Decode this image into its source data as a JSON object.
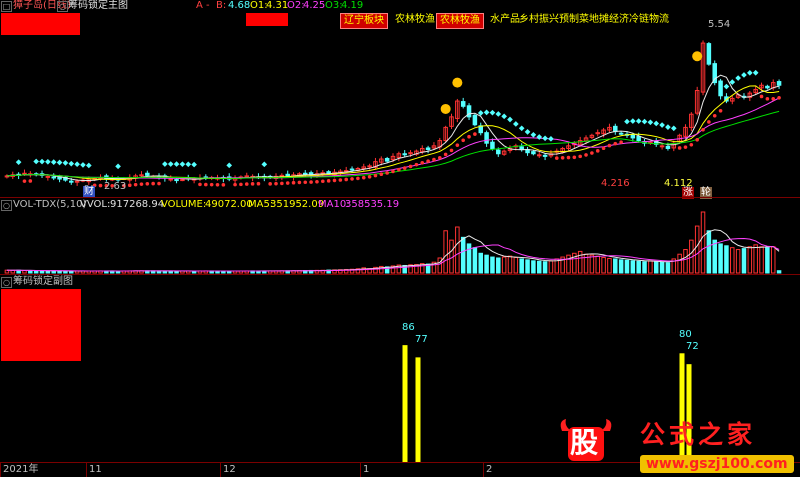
{
  "main": {
    "stock_name": "獐子岛(日线)",
    "indicator_name": "筹码锁定主图",
    "legend": {
      "a_label": "A",
      "dash_label": "-",
      "b_label": "B:",
      "b_value": "4.68",
      "o1_label": "O1:",
      "o1_value": "4.31",
      "o2_label": "O2:",
      "o2_value": "4.25",
      "o3_label": "O3:",
      "o3_value": "4.19"
    },
    "tags": [
      "辽宁板块",
      "农林牧渔",
      "农林牧渔",
      "水产品",
      "乡村振兴",
      "预制菜",
      "地摊经济",
      "冷链物流"
    ],
    "price_labels": {
      "low_left": "2.63",
      "high_right": "5.54",
      "mid_low": "4.216",
      "right_low": "4.112"
    },
    "markers": {
      "cai": "财",
      "zhang": "涨",
      "lun": "轮"
    }
  },
  "volume": {
    "title": "VOL-TDX(5,10)",
    "vvol_label": "VVOL:",
    "vvol_value": "917268.94",
    "volume_label": "VOLUME:",
    "volume_value": "49072.00",
    "ma5_label": "MA5:",
    "ma5_value": "351952.09",
    "ma10_label": "MA10:",
    "ma10_value": "358535.19"
  },
  "sub": {
    "title": "筹码锁定副图",
    "bar_labels": [
      "86",
      "77",
      "80",
      "72"
    ]
  },
  "xaxis": {
    "labels": [
      "2021年",
      "11",
      "12",
      "1",
      "2"
    ]
  },
  "watermark": {
    "logo_char": "股",
    "site_name": "公式之家",
    "url": "www.gszj100.com"
  },
  "colors": {
    "up": "#ff3232",
    "down": "#54ffff",
    "ma_white": "#e8e8e8",
    "ma_yellow": "#ffff00",
    "ma_magenta": "#ff40ff",
    "ma_green": "#00e000",
    "lock_bar": "#ffff00",
    "axis_red": "#8b0000"
  },
  "chart_data": {
    "type": "candlestick",
    "title": "獐子岛(日线)",
    "ylabel": "",
    "annotated_prices": {
      "low": 2.63,
      "high": 5.54,
      "low_mid": 4.216,
      "low_right": 4.112
    },
    "closes": [
      2.78,
      2.8,
      2.79,
      2.83,
      2.82,
      2.8,
      2.79,
      2.77,
      2.74,
      2.72,
      2.7,
      2.66,
      2.68,
      2.7,
      2.72,
      2.73,
      2.75,
      2.74,
      2.72,
      2.71,
      2.73,
      2.75,
      2.78,
      2.8,
      2.79,
      2.77,
      2.76,
      2.74,
      2.72,
      2.7,
      2.71,
      2.73,
      2.72,
      2.74,
      2.76,
      2.75,
      2.74,
      2.73,
      2.72,
      2.74,
      2.76,
      2.78,
      2.77,
      2.76,
      2.74,
      2.75,
      2.77,
      2.79,
      2.78,
      2.8,
      2.82,
      2.81,
      2.8,
      2.82,
      2.84,
      2.83,
      2.85,
      2.87,
      2.88,
      2.9,
      2.92,
      2.95,
      2.97,
      3.05,
      3.1,
      3.06,
      3.15,
      3.2,
      3.18,
      3.22,
      3.25,
      3.3,
      3.28,
      3.35,
      3.45,
      3.7,
      3.9,
      4.2,
      4.1,
      3.9,
      3.75,
      3.6,
      3.4,
      3.3,
      3.2,
      3.25,
      3.3,
      3.35,
      3.28,
      3.22,
      3.2,
      3.18,
      3.15,
      3.2,
      3.25,
      3.3,
      3.35,
      3.4,
      3.45,
      3.5,
      3.55,
      3.6,
      3.65,
      3.7,
      3.62,
      3.58,
      3.55,
      3.5,
      3.45,
      3.4,
      3.42,
      3.38,
      3.35,
      3.3,
      3.4,
      3.55,
      3.7,
      3.95,
      4.4,
      5.3,
      4.9,
      4.55,
      4.3,
      4.2,
      4.25,
      4.32,
      4.28,
      4.35,
      4.42,
      4.5,
      4.45,
      4.55,
      4.5
    ],
    "volume": [
      60,
      55,
      58,
      52,
      50,
      48,
      46,
      45,
      44,
      43,
      42,
      40,
      41,
      42,
      43,
      44,
      45,
      44,
      43,
      42,
      44,
      45,
      46,
      47,
      46,
      45,
      44,
      43,
      42,
      41,
      42,
      43,
      42,
      44,
      45,
      44,
      43,
      42,
      41,
      42,
      43,
      44,
      45,
      44,
      43,
      44,
      45,
      46,
      47,
      48,
      50,
      52,
      54,
      56,
      58,
      62,
      66,
      70,
      75,
      80,
      90,
      110,
      95,
      120,
      140,
      130,
      150,
      170,
      160,
      175,
      180,
      200,
      190,
      230,
      320,
      900,
      700,
      980,
      760,
      620,
      540,
      420,
      380,
      340,
      320,
      340,
      360,
      330,
      300,
      280,
      260,
      250,
      240,
      260,
      300,
      340,
      380,
      420,
      460,
      400,
      380,
      360,
      330,
      310,
      300,
      280,
      270,
      260,
      250,
      240,
      260,
      240,
      230,
      220,
      300,
      400,
      500,
      700,
      1000,
      1300,
      900,
      700,
      620,
      580,
      540,
      500,
      520,
      560,
      600,
      560,
      540,
      560,
      49
    ],
    "lock_bars": [
      {
        "value": 86,
        "position": "first"
      },
      {
        "value": 77,
        "position": "first"
      },
      {
        "value": 80,
        "position": "second"
      },
      {
        "value": 72,
        "position": "second"
      }
    ]
  }
}
